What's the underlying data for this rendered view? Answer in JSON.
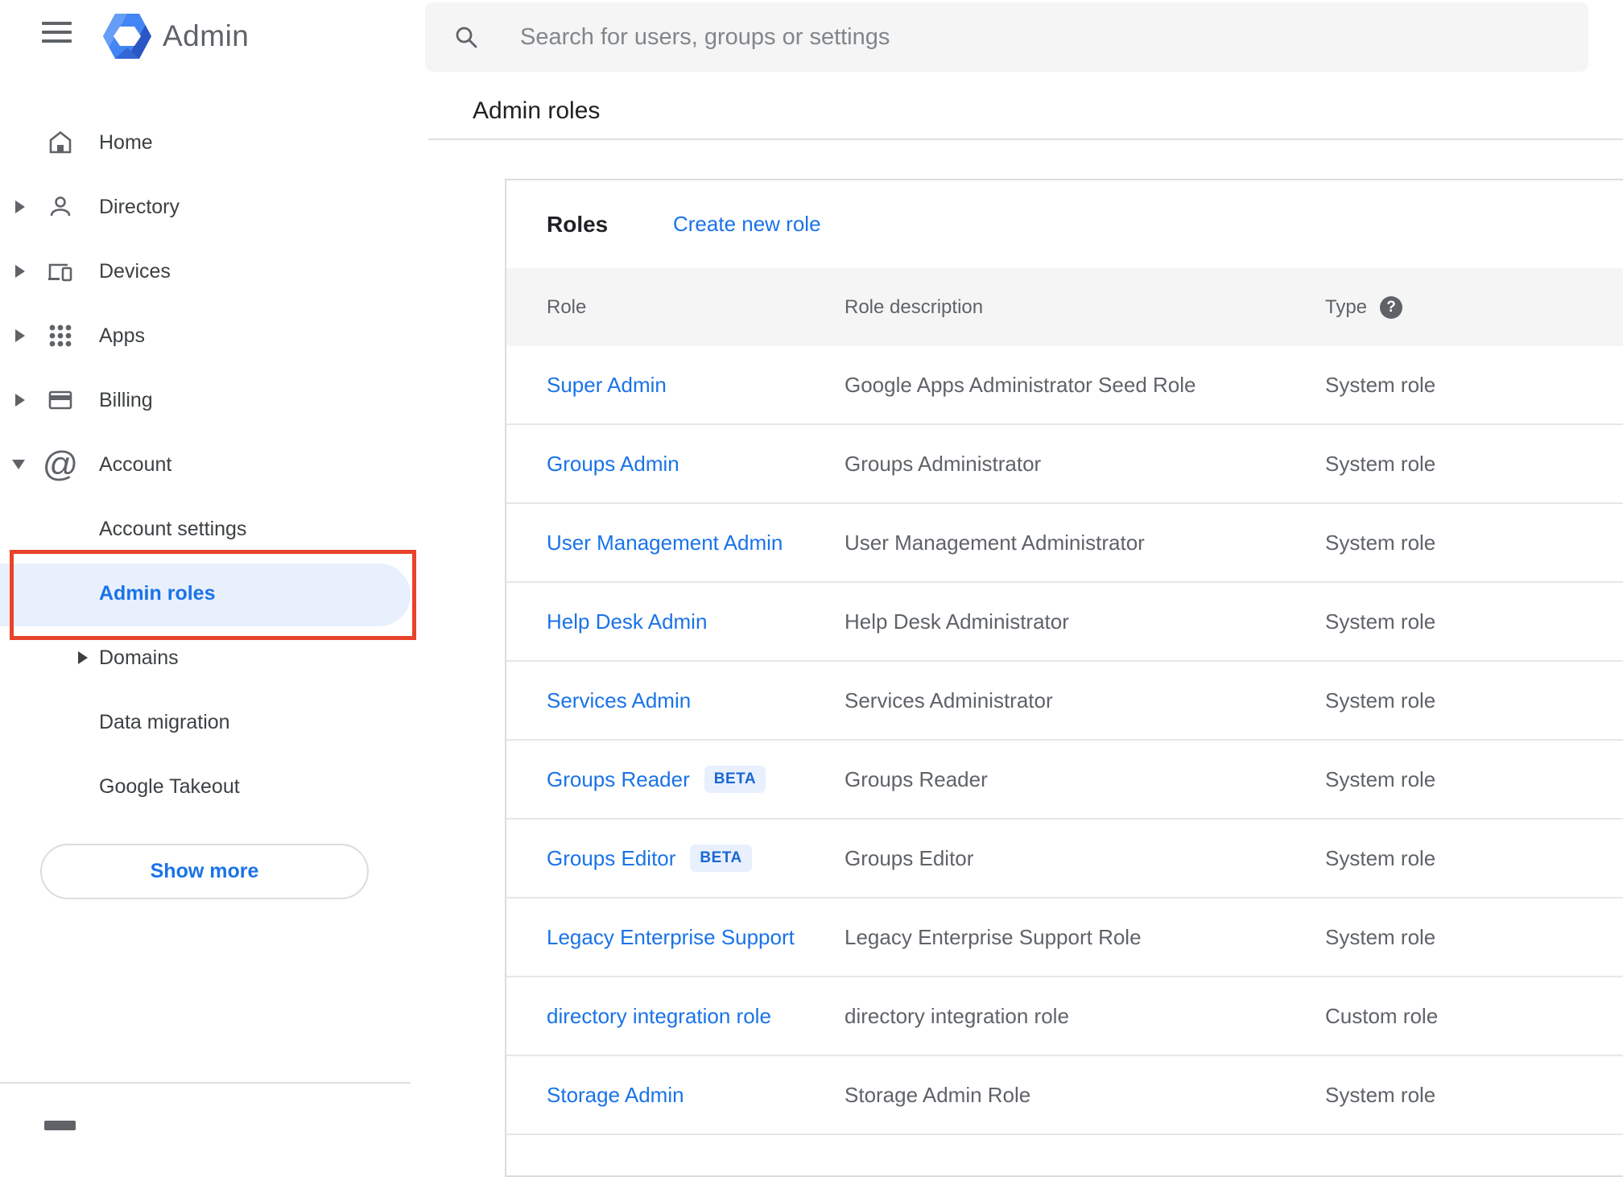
{
  "app": {
    "logo_text": "Admin"
  },
  "search": {
    "placeholder": "Search for users, groups or settings"
  },
  "page": {
    "title": "Admin roles"
  },
  "sidebar": {
    "items": [
      {
        "label": "Home"
      },
      {
        "label": "Directory"
      },
      {
        "label": "Devices"
      },
      {
        "label": "Apps"
      },
      {
        "label": "Billing"
      },
      {
        "label": "Account"
      }
    ],
    "account_subitems": [
      {
        "label": "Account settings"
      },
      {
        "label": "Admin roles",
        "selected": true
      },
      {
        "label": "Domains"
      },
      {
        "label": "Data migration"
      },
      {
        "label": "Google Takeout"
      }
    ],
    "show_more_label": "Show more"
  },
  "roles_card": {
    "heading": "Roles",
    "create_link": "Create new role",
    "columns": {
      "role": "Role",
      "description": "Role description",
      "type": "Type"
    },
    "help_glyph": "?",
    "rows": [
      {
        "role": "Super Admin",
        "description": "Google Apps Administrator Seed Role",
        "type": "System role"
      },
      {
        "role": "Groups Admin",
        "description": "Groups Administrator",
        "type": "System role"
      },
      {
        "role": "User Management Admin",
        "description": "User Management Administrator",
        "type": "System role"
      },
      {
        "role": "Help Desk Admin",
        "description": "Help Desk Administrator",
        "type": "System role"
      },
      {
        "role": "Services Admin",
        "description": "Services Administrator",
        "type": "System role"
      },
      {
        "role": "Groups Reader",
        "badge": "BETA",
        "description": "Groups Reader",
        "type": "System role"
      },
      {
        "role": "Groups Editor",
        "badge": "BETA",
        "description": "Groups Editor",
        "type": "System role"
      },
      {
        "role": "Legacy Enterprise Support",
        "description": "Legacy Enterprise Support Role",
        "type": "System role"
      },
      {
        "role": "directory integration role",
        "description": "directory integration role",
        "type": "Custom role"
      },
      {
        "role": "Storage Admin",
        "description": "Storage Admin Role",
        "type": "System role"
      }
    ]
  },
  "colors": {
    "accent_blue": "#1a73e8",
    "selected_item_bg": "#e8f0fe",
    "beta_badge_bg": "#e8f0fe",
    "beta_badge_text": "#1967d2",
    "annotation_red": "#e8432a",
    "table_header_bg": "#f5f5f5",
    "search_bg": "#f5f5f5",
    "text_primary": "#202124",
    "text_secondary": "#5f6368"
  }
}
